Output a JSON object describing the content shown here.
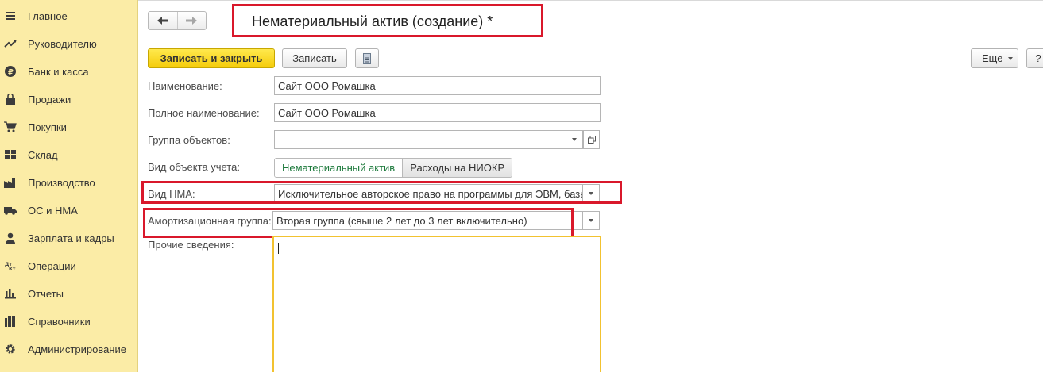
{
  "sidebar": {
    "items": [
      {
        "label": "Главное",
        "icon": "menu-icon"
      },
      {
        "label": "Руководителю",
        "icon": "trend-icon"
      },
      {
        "label": "Банк и касса",
        "icon": "ruble-icon"
      },
      {
        "label": "Продажи",
        "icon": "bag-icon"
      },
      {
        "label": "Покупки",
        "icon": "cart-icon"
      },
      {
        "label": "Склад",
        "icon": "grid-icon"
      },
      {
        "label": "Производство",
        "icon": "factory-icon"
      },
      {
        "label": "ОС и НМА",
        "icon": "truck-icon"
      },
      {
        "label": "Зарплата и кадры",
        "icon": "person-icon"
      },
      {
        "label": "Операции",
        "icon": "dt-kt-icon"
      },
      {
        "label": "Отчеты",
        "icon": "bar-chart-icon"
      },
      {
        "label": "Справочники",
        "icon": "books-icon"
      },
      {
        "label": "Администрирование",
        "icon": "gear-icon"
      }
    ]
  },
  "header": {
    "title": "Нематериальный актив (создание) *"
  },
  "toolbar": {
    "save_close": "Записать и закрыть",
    "save": "Записать",
    "more": "Еще",
    "help": "?"
  },
  "form": {
    "name_label": "Наименование:",
    "name_value": "Сайт ООО Ромашка",
    "full_name_label": "Полное наименование:",
    "full_name_value": "Сайт ООО Ромашка",
    "group_label": "Группа объектов:",
    "group_value": "",
    "account_type_label": "Вид объекта учета:",
    "account_type_options": [
      "Нематериальный актив",
      "Расходы на НИОКР"
    ],
    "nma_type_label": "Вид НМА:",
    "nma_type_value": "Исключительное авторское право на программы для ЭВМ, базы данных",
    "amort_label": "Амортизационная группа:",
    "amort_value": "Вторая группа (свыше 2 лет до 3 лет включительно)",
    "other_label": "Прочие сведения:",
    "other_value": ""
  }
}
